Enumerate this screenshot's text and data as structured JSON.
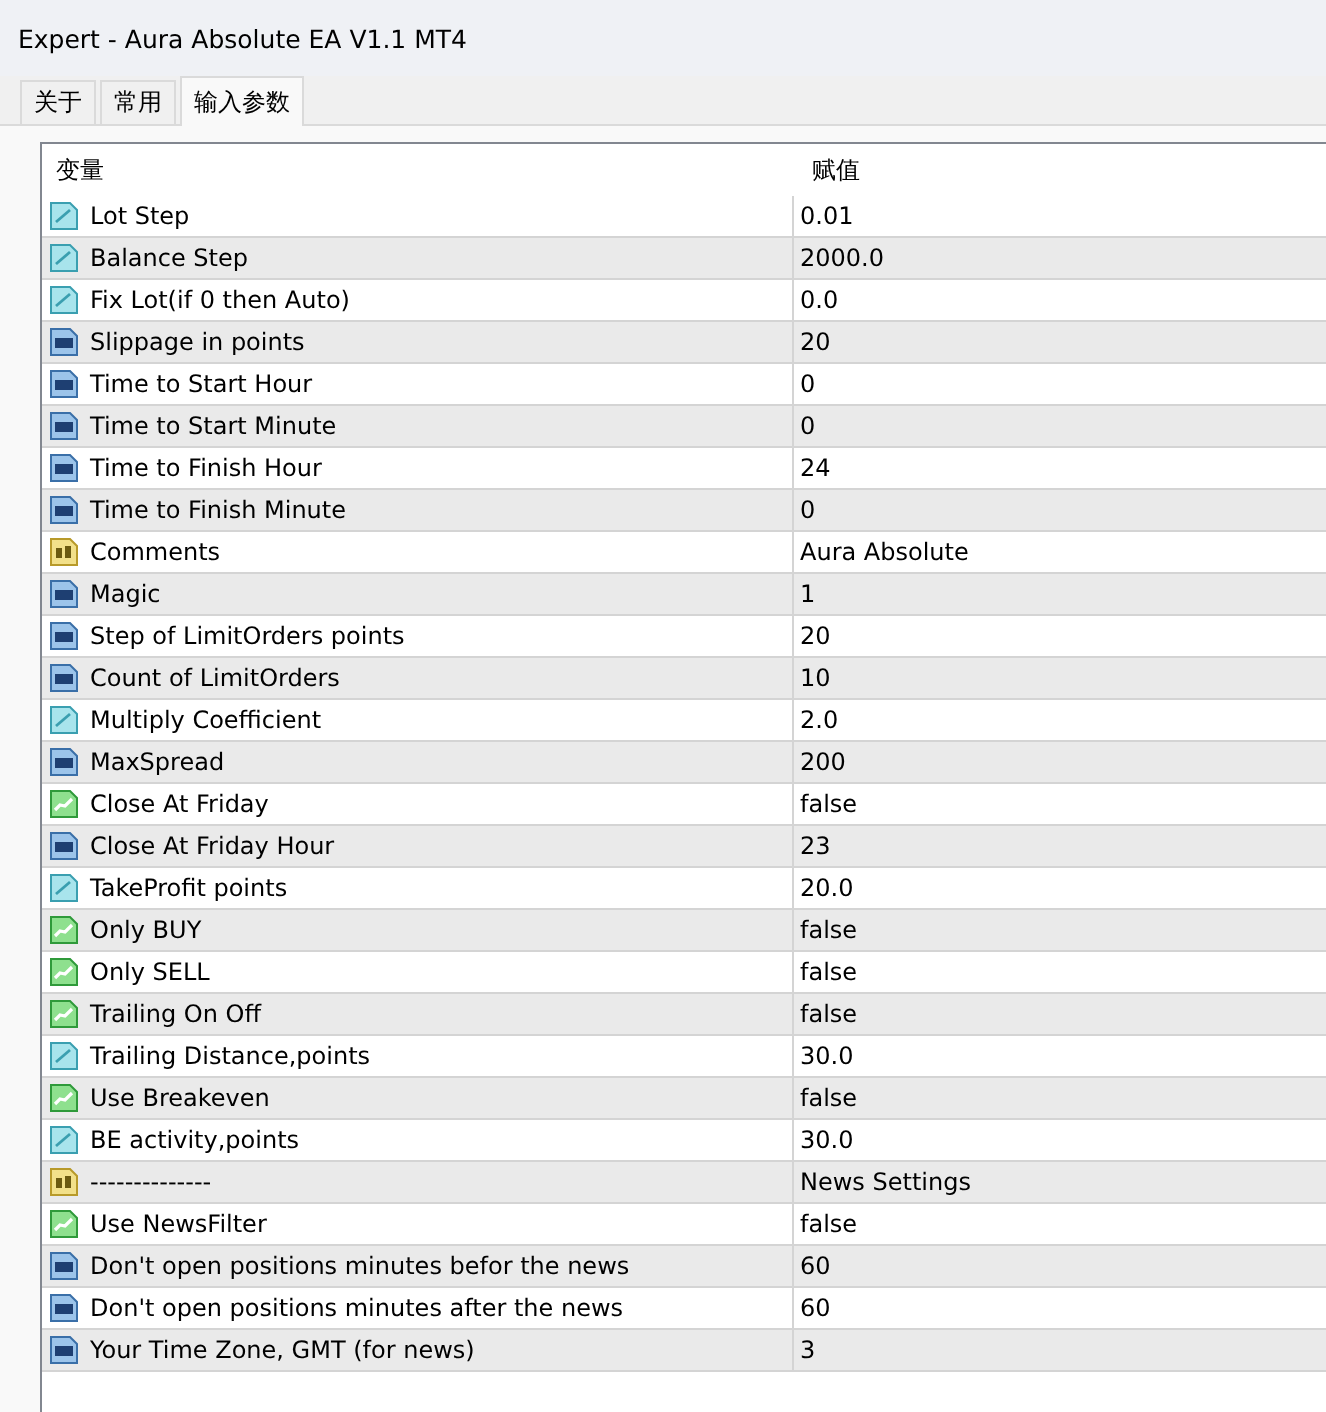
{
  "window": {
    "title": "Expert - Aura Absolute EA V1.1 MT4"
  },
  "tabs": [
    {
      "label": "关于",
      "selected": false
    },
    {
      "label": "常用",
      "selected": false
    },
    {
      "label": "输入参数",
      "selected": true
    }
  ],
  "table": {
    "columns": [
      "变量",
      "赋值"
    ],
    "rows": [
      {
        "kind": "double",
        "name": "Lot Step",
        "value": "0.01"
      },
      {
        "kind": "double",
        "name": "Balance Step",
        "value": "2000.0"
      },
      {
        "kind": "double",
        "name": "Fix Lot(if 0 then Auto)",
        "value": "0.0"
      },
      {
        "kind": "int",
        "name": "Slippage in points",
        "value": "20"
      },
      {
        "kind": "int",
        "name": "Time to Start Hour",
        "value": "0"
      },
      {
        "kind": "int",
        "name": "Time to Start Minute",
        "value": "0"
      },
      {
        "kind": "int",
        "name": "Time to Finish Hour",
        "value": "24"
      },
      {
        "kind": "int",
        "name": "Time to Finish Minute",
        "value": "0"
      },
      {
        "kind": "string",
        "name": "Comments",
        "value": "Aura Absolute"
      },
      {
        "kind": "int",
        "name": "Magic",
        "value": "1"
      },
      {
        "kind": "int",
        "name": "Step of LimitOrders points",
        "value": "20"
      },
      {
        "kind": "int",
        "name": "Count of LimitOrders",
        "value": "10"
      },
      {
        "kind": "double",
        "name": "Multiply Coefficient",
        "value": "2.0"
      },
      {
        "kind": "int",
        "name": "MaxSpread",
        "value": "200"
      },
      {
        "kind": "bool",
        "name": "Close At Friday",
        "value": "false"
      },
      {
        "kind": "int",
        "name": "Close At Friday Hour",
        "value": "23"
      },
      {
        "kind": "double",
        "name": "TakeProfit points",
        "value": "20.0"
      },
      {
        "kind": "bool",
        "name": "Only BUY",
        "value": "false"
      },
      {
        "kind": "bool",
        "name": "Only SELL",
        "value": "false"
      },
      {
        "kind": "bool",
        "name": "Trailing On Off",
        "value": "false"
      },
      {
        "kind": "double",
        "name": "Trailing Distance,points",
        "value": "30.0"
      },
      {
        "kind": "bool",
        "name": "Use Breakeven",
        "value": "false"
      },
      {
        "kind": "double",
        "name": "BE activity,points",
        "value": "30.0"
      },
      {
        "kind": "string",
        "name": "--------------",
        "value": "News Settings"
      },
      {
        "kind": "bool",
        "name": "Use NewsFilter",
        "value": "false"
      },
      {
        "kind": "int",
        "name": "Don't open positions minutes befor the news",
        "value": "60"
      },
      {
        "kind": "int",
        "name": "Don't open positions minutes after the news",
        "value": "60"
      },
      {
        "kind": "int",
        "name": "Your Time Zone, GMT (for news)",
        "value": "3"
      }
    ]
  }
}
